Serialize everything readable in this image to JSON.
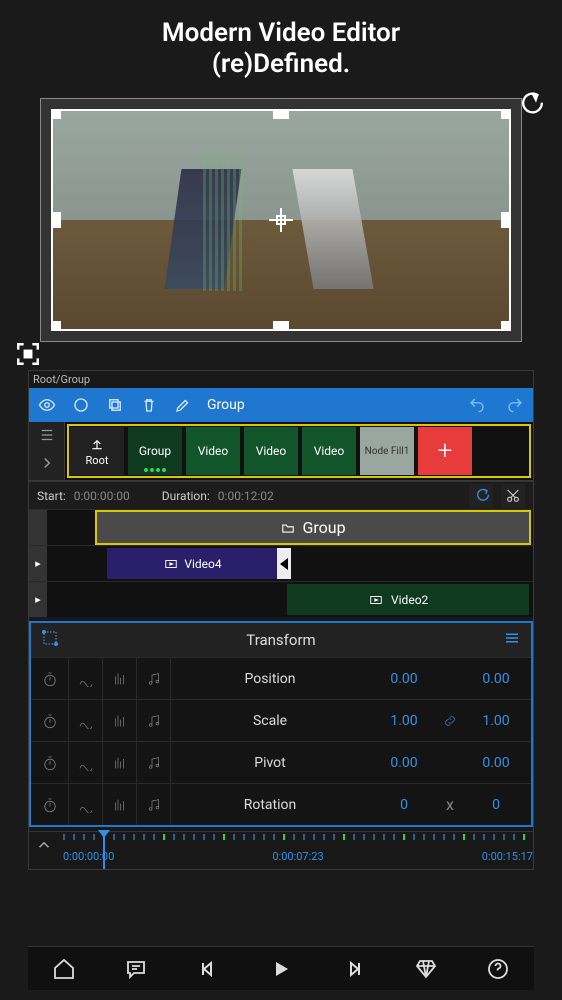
{
  "hero": {
    "line1": "Modern Video Editor",
    "line2": "(re)Defined."
  },
  "breadcrumb": "Root/Group",
  "toolbar": {
    "selected_label": "Group"
  },
  "strip": {
    "root_label": "Root",
    "items": [
      {
        "label": "Group",
        "kind": "group"
      },
      {
        "label": "Video",
        "kind": "vid"
      },
      {
        "label": "Video",
        "kind": "vid"
      },
      {
        "label": "Video",
        "kind": "vid"
      },
      {
        "label": "Node Fill1",
        "kind": "fill"
      }
    ],
    "add_label": "+"
  },
  "timing": {
    "start_label": "Start:",
    "start_value": "0:00:00:00",
    "duration_label": "Duration:",
    "duration_value": "0:00:12:02"
  },
  "tracks": {
    "group_label": "Group",
    "video4_label": "Video4",
    "video2_label": "Video2"
  },
  "transform": {
    "title": "Transform",
    "rows": [
      {
        "label": "Position",
        "v1": "0.00",
        "v2": "0.00",
        "link": false
      },
      {
        "label": "Scale",
        "v1": "1.00",
        "v2": "1.00",
        "link": true
      },
      {
        "label": "Pivot",
        "v1": "0.00",
        "v2": "0.00",
        "link": false
      },
      {
        "label": "Rotation",
        "v1": "0",
        "mid": "x",
        "v2": "0",
        "link": false
      }
    ]
  },
  "ruler": {
    "t0": "0:00:00:00",
    "t1": "0:00:07:23",
    "t2": "0:00:15:17"
  }
}
